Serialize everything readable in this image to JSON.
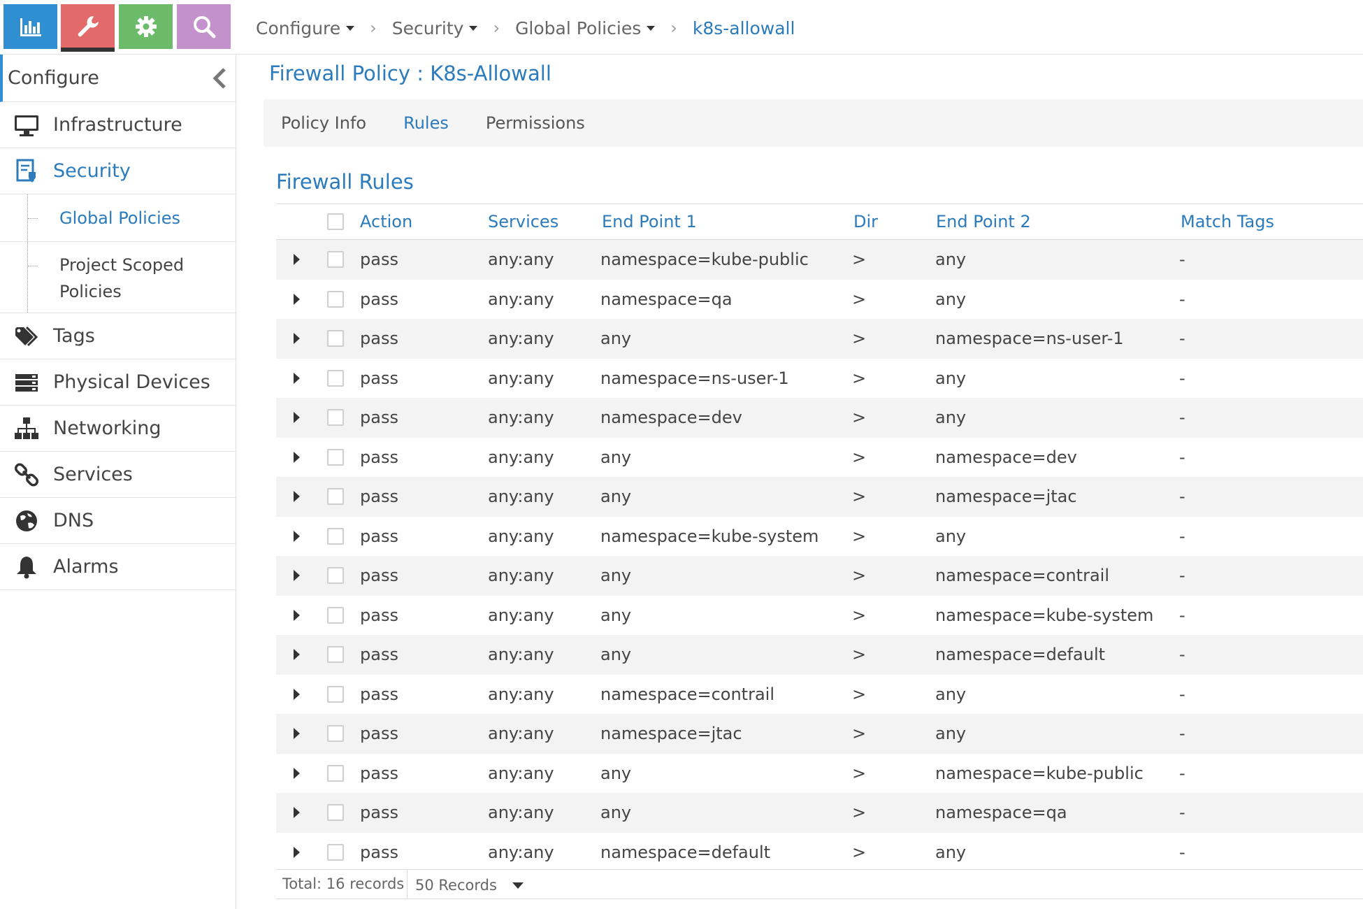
{
  "topbar": {
    "icons": [
      "bar-chart-icon",
      "wrench-icon",
      "gear-icon",
      "search-icon"
    ],
    "colors": {
      "monitor": "#2f8fd0",
      "configure": "#e26a6a",
      "settings": "#6bbb6b",
      "query": "#c392cc"
    }
  },
  "breadcrumb": {
    "items": [
      "Configure",
      "Security",
      "Global Policies"
    ],
    "current": "k8s-allowall"
  },
  "sidebar": {
    "header": "Configure",
    "items": [
      {
        "label": "Infrastructure",
        "icon": "monitor-icon"
      },
      {
        "label": "Security",
        "icon": "security-document-icon"
      },
      {
        "label": "Tags",
        "icon": "tags-icon"
      },
      {
        "label": "Physical Devices",
        "icon": "server-rack-icon"
      },
      {
        "label": "Networking",
        "icon": "network-tree-icon"
      },
      {
        "label": "Services",
        "icon": "link-chain-icon"
      },
      {
        "label": "DNS",
        "icon": "globe-icon"
      },
      {
        "label": "Alarms",
        "icon": "bell-icon"
      }
    ],
    "security_sub": {
      "global_policies": "Global Policies",
      "project_scoped_line1": "Project Scoped",
      "project_scoped_line2": "Policies"
    }
  },
  "page": {
    "title": "Firewall Policy : K8s-Allowall",
    "tabs": [
      "Policy Info",
      "Rules",
      "Permissions"
    ],
    "active_tab": "Rules",
    "section_title": "Firewall Rules"
  },
  "table": {
    "columns": [
      "Action",
      "Services",
      "End Point 1",
      "Dir",
      "End Point 2",
      "Match Tags"
    ],
    "rows": [
      {
        "action": "pass",
        "services": "any:any",
        "ep1": "namespace=kube-public",
        "dir": ">",
        "ep2": "any",
        "tags": "-"
      },
      {
        "action": "pass",
        "services": "any:any",
        "ep1": "namespace=qa",
        "dir": ">",
        "ep2": "any",
        "tags": "-"
      },
      {
        "action": "pass",
        "services": "any:any",
        "ep1": "any",
        "dir": ">",
        "ep2": "namespace=ns-user-1",
        "tags": "-"
      },
      {
        "action": "pass",
        "services": "any:any",
        "ep1": "namespace=ns-user-1",
        "dir": ">",
        "ep2": "any",
        "tags": "-"
      },
      {
        "action": "pass",
        "services": "any:any",
        "ep1": "namespace=dev",
        "dir": ">",
        "ep2": "any",
        "tags": "-"
      },
      {
        "action": "pass",
        "services": "any:any",
        "ep1": "any",
        "dir": ">",
        "ep2": "namespace=dev",
        "tags": "-"
      },
      {
        "action": "pass",
        "services": "any:any",
        "ep1": "any",
        "dir": ">",
        "ep2": "namespace=jtac",
        "tags": "-"
      },
      {
        "action": "pass",
        "services": "any:any",
        "ep1": "namespace=kube-system",
        "dir": ">",
        "ep2": "any",
        "tags": "-"
      },
      {
        "action": "pass",
        "services": "any:any",
        "ep1": "any",
        "dir": ">",
        "ep2": "namespace=contrail",
        "tags": "-"
      },
      {
        "action": "pass",
        "services": "any:any",
        "ep1": "any",
        "dir": ">",
        "ep2": "namespace=kube-system",
        "tags": "-"
      },
      {
        "action": "pass",
        "services": "any:any",
        "ep1": "any",
        "dir": ">",
        "ep2": "namespace=default",
        "tags": "-"
      },
      {
        "action": "pass",
        "services": "any:any",
        "ep1": "namespace=contrail",
        "dir": ">",
        "ep2": "any",
        "tags": "-"
      },
      {
        "action": "pass",
        "services": "any:any",
        "ep1": "namespace=jtac",
        "dir": ">",
        "ep2": "any",
        "tags": "-"
      },
      {
        "action": "pass",
        "services": "any:any",
        "ep1": "any",
        "dir": ">",
        "ep2": "namespace=kube-public",
        "tags": "-"
      },
      {
        "action": "pass",
        "services": "any:any",
        "ep1": "any",
        "dir": ">",
        "ep2": "namespace=qa",
        "tags": "-"
      },
      {
        "action": "pass",
        "services": "any:any",
        "ep1": "namespace=default",
        "dir": ">",
        "ep2": "any",
        "tags": "-"
      }
    ]
  },
  "footer": {
    "total": "Total: 16 records",
    "page_size": "50 Records"
  }
}
